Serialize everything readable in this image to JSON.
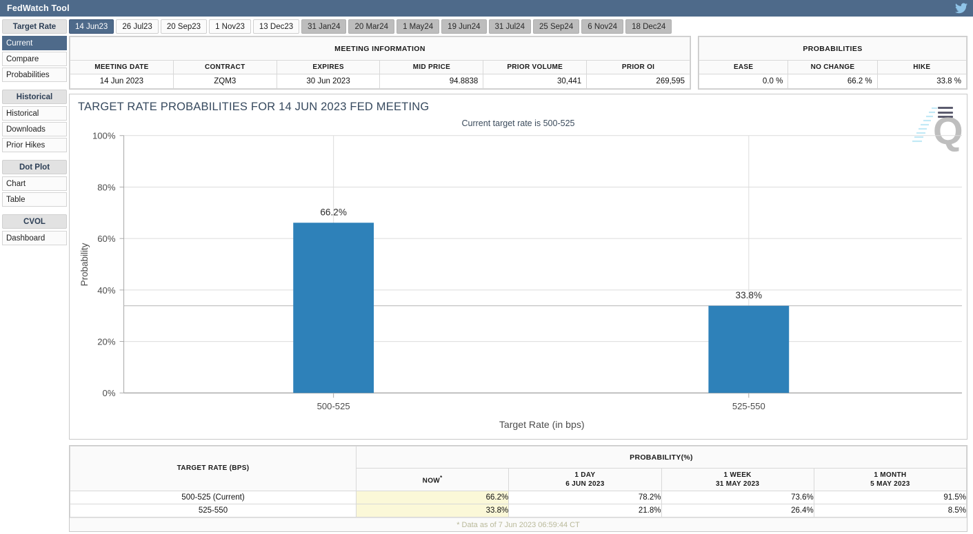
{
  "topbar": {
    "title": "FedWatch Tool",
    "twitter_icon": "twitter-icon"
  },
  "sidebar": {
    "groups": [
      {
        "label": "Target Rate",
        "items": [
          {
            "label": "Current",
            "active": true
          },
          {
            "label": "Compare",
            "active": false
          },
          {
            "label": "Probabilities",
            "active": false
          }
        ]
      },
      {
        "label": "Historical",
        "items": [
          {
            "label": "Historical",
            "active": false
          },
          {
            "label": "Downloads",
            "active": false
          },
          {
            "label": "Prior Hikes",
            "active": false
          }
        ]
      },
      {
        "label": "Dot Plot",
        "items": [
          {
            "label": "Chart",
            "active": false
          },
          {
            "label": "Table",
            "active": false
          }
        ]
      },
      {
        "label": "CVOL",
        "items": [
          {
            "label": "Dashboard",
            "active": false
          }
        ]
      }
    ]
  },
  "tabs": [
    {
      "label": "14 Jun23",
      "state": "active"
    },
    {
      "label": "26 Jul23",
      "state": "enabled"
    },
    {
      "label": "20 Sep23",
      "state": "enabled"
    },
    {
      "label": "1 Nov23",
      "state": "enabled"
    },
    {
      "label": "13 Dec23",
      "state": "enabled"
    },
    {
      "label": "31 Jan24",
      "state": "disabled"
    },
    {
      "label": "20 Mar24",
      "state": "disabled"
    },
    {
      "label": "1 May24",
      "state": "disabled"
    },
    {
      "label": "19 Jun24",
      "state": "disabled"
    },
    {
      "label": "31 Jul24",
      "state": "disabled"
    },
    {
      "label": "25 Sep24",
      "state": "disabled"
    },
    {
      "label": "6 Nov24",
      "state": "disabled"
    },
    {
      "label": "18 Dec24",
      "state": "disabled"
    }
  ],
  "meeting_information": {
    "caption": "MEETING INFORMATION",
    "headers": [
      "MEETING DATE",
      "CONTRACT",
      "EXPIRES",
      "MID PRICE",
      "PRIOR VOLUME",
      "PRIOR OI"
    ],
    "row": {
      "meeting_date": "14 Jun 2023",
      "contract": "ZQM3",
      "expires": "30 Jun 2023",
      "mid_price": "94.8838",
      "prior_volume": "30,441",
      "prior_oi": "269,595"
    }
  },
  "probabilities_summary": {
    "caption": "PROBABILITIES",
    "headers": [
      "EASE",
      "NO CHANGE",
      "HIKE"
    ],
    "row": {
      "ease": "0.0 %",
      "no_change": "66.2 %",
      "hike": "33.8 %"
    }
  },
  "chart_header": {
    "title": "TARGET RATE PROBABILITIES FOR 14 JUN 2023 FED MEETING",
    "subtitle": "Current target rate is 500-525",
    "menu_icon": "hamburger-menu-icon",
    "watermark": "q-watermark-logo"
  },
  "chart_data": {
    "type": "bar",
    "title": "TARGET RATE PROBABILITIES FOR 14 JUN 2023 FED MEETING",
    "subtitle": "Current target rate is 500-525",
    "categories": [
      "500-525",
      "525-550"
    ],
    "values": [
      66.2,
      33.8
    ],
    "data_labels": [
      "66.2%",
      "33.8%"
    ],
    "xlabel": "Target Rate (in bps)",
    "ylabel": "Probability",
    "ylim": [
      0,
      100
    ],
    "yticks": [
      0,
      20,
      40,
      60,
      80,
      100
    ],
    "ytick_labels": [
      "0%",
      "20%",
      "40%",
      "60%",
      "80%",
      "100%"
    ],
    "grid": true,
    "legend": false,
    "bar_color": "#2e81b9"
  },
  "probability_table": {
    "left_header": "TARGET RATE (BPS)",
    "group_header": "PROBABILITY(%)",
    "columns": [
      {
        "line1": "NOW",
        "line2": "",
        "sup": "*"
      },
      {
        "line1": "1 DAY",
        "line2": "6 JUN 2023",
        "sup": ""
      },
      {
        "line1": "1 WEEK",
        "line2": "31 MAY 2023",
        "sup": ""
      },
      {
        "line1": "1 MONTH",
        "line2": "5 MAY 2023",
        "sup": ""
      }
    ],
    "rows": [
      {
        "label": "500-525 (Current)",
        "now": "66.2%",
        "day1": "78.2%",
        "week1": "73.6%",
        "month1": "91.5%"
      },
      {
        "label": "525-550",
        "now": "33.8%",
        "day1": "21.8%",
        "week1": "26.4%",
        "month1": "8.5%"
      }
    ],
    "footnote": "* Data as of 7 Jun 2023 06:59:44 CT"
  },
  "colors": {
    "header_bar": "#4e6a8a",
    "accent": "#2e81b9",
    "highlight": "#fbf8d8"
  }
}
